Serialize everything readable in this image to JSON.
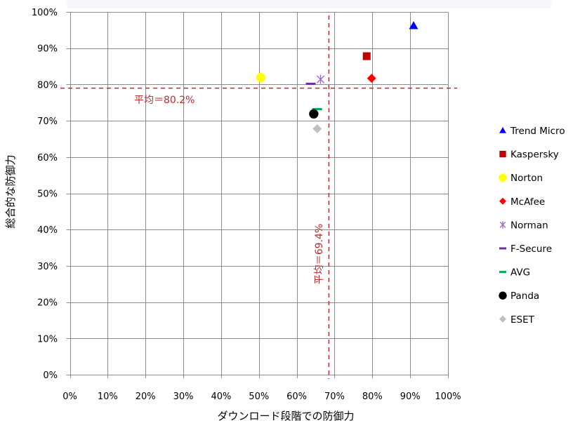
{
  "chart_data": {
    "type": "scatter",
    "title": "",
    "xlabel": "ダウンロード段階での防御力",
    "ylabel": "総合的な防御力",
    "xlim": [
      0,
      100
    ],
    "ylim": [
      0,
      100
    ],
    "x_ticks": [
      "0%",
      "10%",
      "20%",
      "30%",
      "40%",
      "50%",
      "60%",
      "70%",
      "80%",
      "90%",
      "100%"
    ],
    "y_ticks": [
      "0%",
      "10%",
      "20%",
      "30%",
      "40%",
      "50%",
      "60%",
      "70%",
      "80%",
      "90%",
      "100%"
    ],
    "grid": true,
    "legend_position": "right",
    "series": [
      {
        "name": "Trend Micro",
        "marker": "triangle",
        "color": "#0000ff",
        "x": 90.9,
        "y": 96.2
      },
      {
        "name": "Kaspersky",
        "marker": "square",
        "color": "#c00000",
        "x": 78.5,
        "y": 87.8
      },
      {
        "name": "Norton",
        "marker": "circle",
        "color": "#ffff00",
        "x": 50.5,
        "y": 81.9
      },
      {
        "name": "McAfee",
        "marker": "diamond",
        "color": "#ff0000",
        "x": 79.8,
        "y": 81.7
      },
      {
        "name": "Norman",
        "marker": "star",
        "color": "#9966cc",
        "x": 66.3,
        "y": 81.4
      },
      {
        "name": "F-Secure",
        "marker": "dash",
        "color": "#7030a0",
        "x": 63.7,
        "y": 80.2
      },
      {
        "name": "AVG",
        "marker": "dash",
        "color": "#00b050",
        "x": 65.4,
        "y": 73.2
      },
      {
        "name": "Panda",
        "marker": "circle",
        "color": "#000000",
        "x": 64.5,
        "y": 71.9
      },
      {
        "name": "ESET",
        "marker": "diamond",
        "color": "#bfbfbf",
        "x": 65.4,
        "y": 67.8
      }
    ],
    "reference_lines": [
      {
        "orientation": "horizontal",
        "value": 79.0,
        "label": "平均＝80.2%",
        "color": "#c0282d",
        "style": "dashed"
      },
      {
        "orientation": "vertical",
        "value": 68.5,
        "label": "平均＝69.4%",
        "color": "#c0282d",
        "style": "dashed"
      }
    ]
  }
}
